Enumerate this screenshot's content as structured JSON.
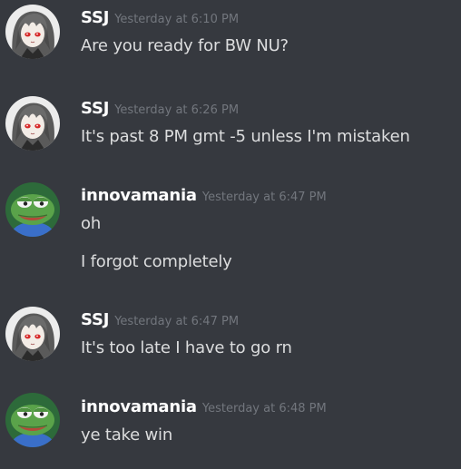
{
  "messages": [
    {
      "author": "SSJ",
      "timestamp": "Yesterday at 6:10 PM",
      "avatar_icon": "anime-girl-avatar-icon",
      "lines": [
        "Are you ready for BW NU?"
      ]
    },
    {
      "author": "SSJ",
      "timestamp": "Yesterday at 6:26 PM",
      "avatar_icon": "anime-girl-avatar-icon",
      "lines": [
        "It's past 8 PM gmt -5 unless I'm mistaken"
      ]
    },
    {
      "author": "innovamania",
      "timestamp": "Yesterday at 6:47 PM",
      "avatar_icon": "pepe-frog-avatar-icon",
      "lines": [
        "oh",
        "I forgot completely"
      ]
    },
    {
      "author": "SSJ",
      "timestamp": "Yesterday at 6:47 PM",
      "avatar_icon": "anime-girl-avatar-icon",
      "lines": [
        "It's too late I have to go rn"
      ]
    },
    {
      "author": "innovamania",
      "timestamp": "Yesterday at 6:48 PM",
      "avatar_icon": "pepe-frog-avatar-icon",
      "lines": [
        "ye take win"
      ]
    }
  ],
  "colors": {
    "background": "#36393f",
    "username": "#ffffff",
    "timestamp": "#72767d",
    "message_text": "#dcddde"
  }
}
